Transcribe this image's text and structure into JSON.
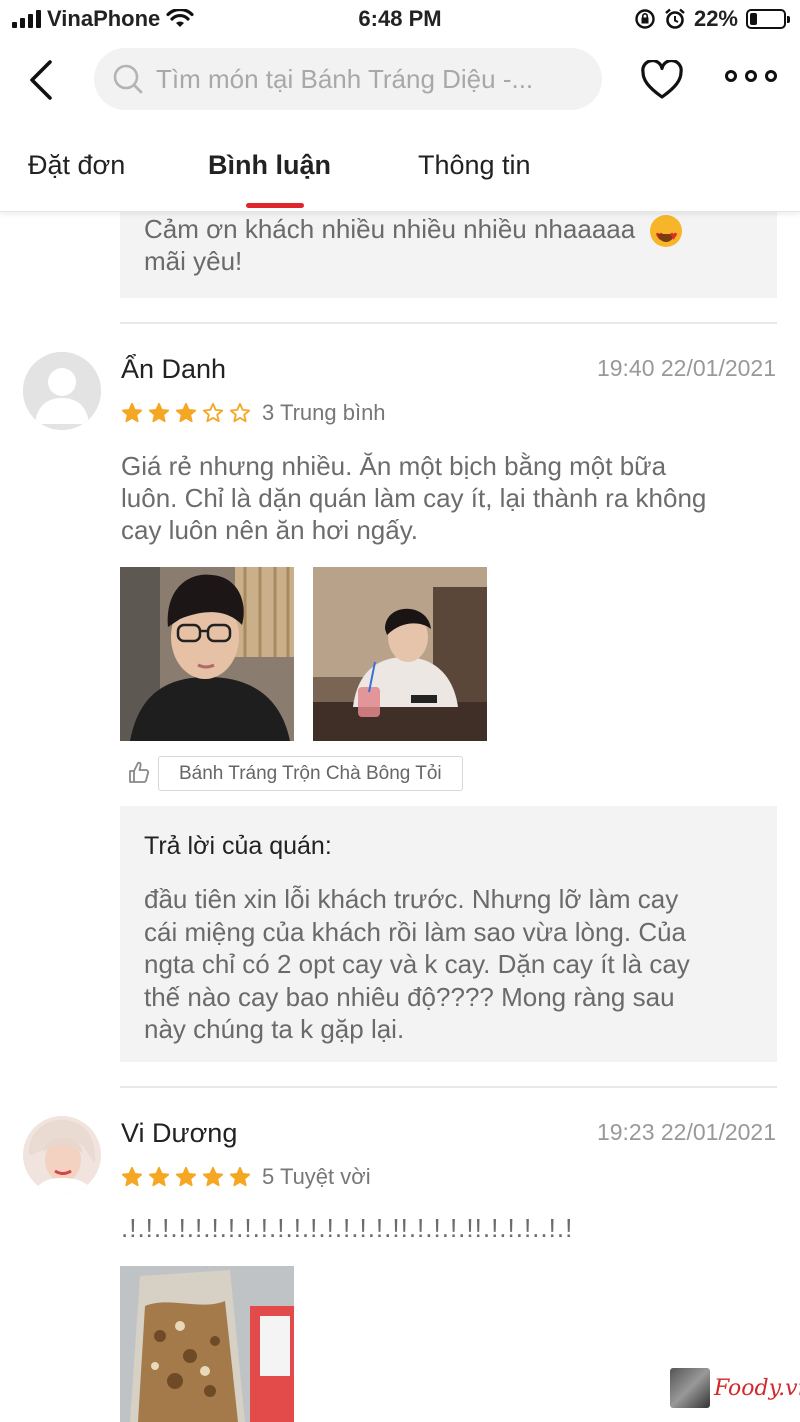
{
  "status_bar": {
    "carrier": "VinaPhone",
    "time": "6:48 PM",
    "battery": "22%",
    "battery_level": 0.22
  },
  "header": {
    "search_placeholder": "Tìm món tại Bánh Tráng Diệu -..."
  },
  "tabs": [
    {
      "label": "Đặt đơn",
      "active": false
    },
    {
      "label": "Bình luận",
      "active": true
    },
    {
      "label": "Thông tin",
      "active": false
    }
  ],
  "previous_reply": {
    "line1": "Cảm ơn khách nhiều nhiều nhiều nhaaaaa",
    "line2": "mãi yêu!"
  },
  "reviews": [
    {
      "name": "Ẩn Danh",
      "date": "19:40 22/01/2021",
      "stars": 3,
      "rating_label": "3 Trung bình",
      "text_lines": [
        "Giá rẻ nhưng nhiều. Ăn một bịch bằng một bữa",
        "luôn. Chỉ là dặn quán làm cay ít, lại thành ra không",
        "cay luôn nên ăn hơi ngấy."
      ],
      "dish_tag": "Bánh Tráng Trộn Chà Bông Tỏi",
      "reply": {
        "title": "Trả lời của quán:",
        "lines": [
          "đầu tiên xin lỗi khách trước. Nhưng lỡ làm cay",
          "cái miệng của khách rồi làm sao vừa lòng. Của",
          "ngta chỉ có 2 opt cay và k cay. Dặn cay ít là cay",
          "thế nào cay bao nhiêu độ???? Mong ràng sau",
          "này chúng ta k gặp lại."
        ]
      }
    },
    {
      "name": "Vi Dương",
      "date": "19:23 22/01/2021",
      "stars": 5,
      "rating_label": "5 Tuyệt vời",
      "text_lines": [
        ".!.!.!.!.!.!.!.!.!.!.!.!.!.!.!.!.!!.!.!.!.!!.!.!.!..!.!"
      ]
    }
  ],
  "watermark": {
    "brand": "Foody.vn"
  },
  "colors": {
    "accent": "#e0252b",
    "star": "#f5a623",
    "muted_text": "#6c6c6c",
    "reply_bg": "#f3f3f3"
  }
}
